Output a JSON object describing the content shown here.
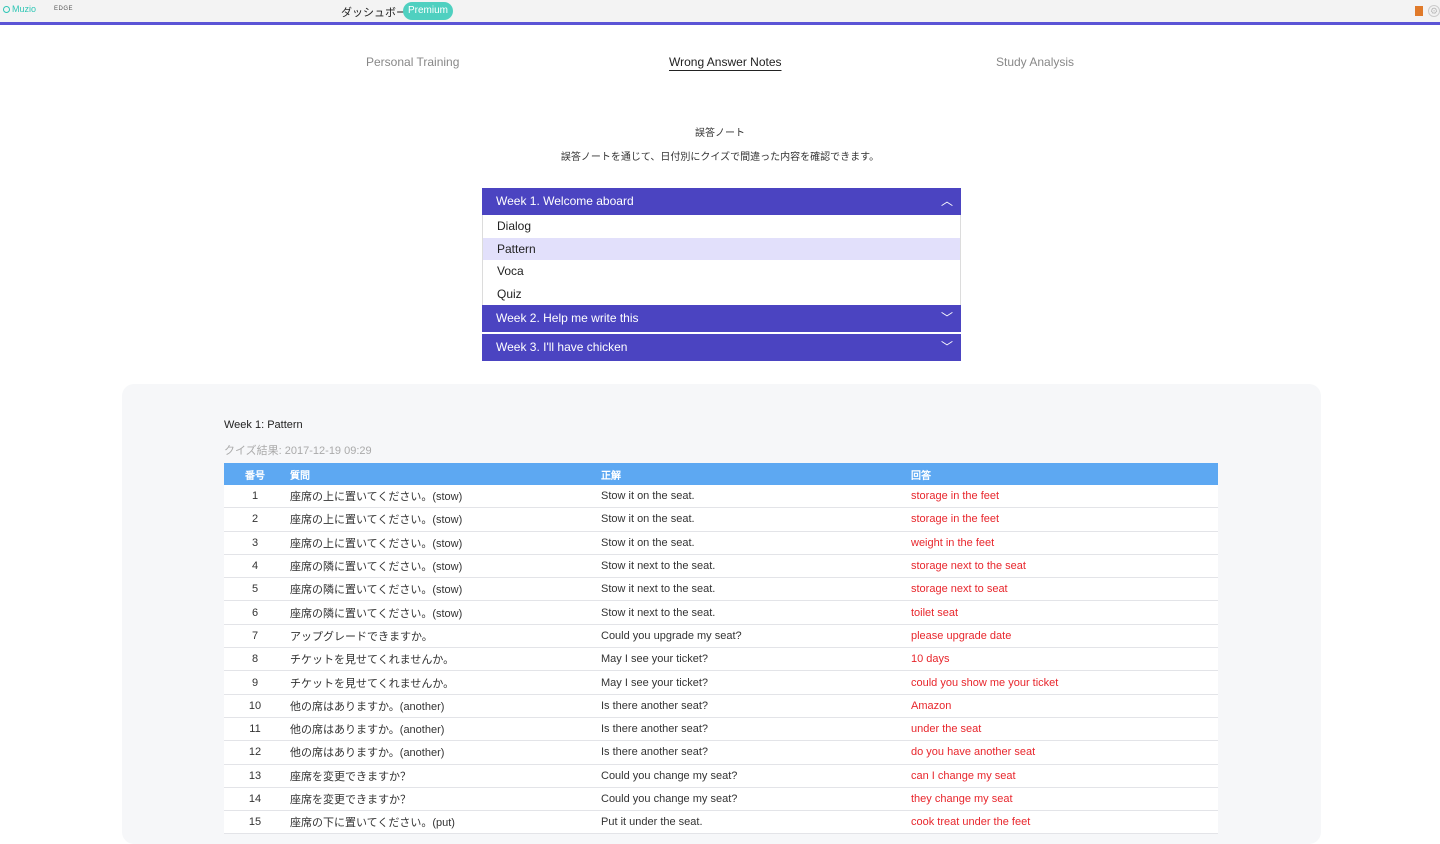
{
  "header": {
    "logo_text": "Muzio",
    "edge_text": "EDGE",
    "dashboard_label": "ダッシュボー",
    "premium_badge": "Premium",
    "accent_color": "#5b54d6"
  },
  "tabs": [
    {
      "label": "Personal Training",
      "active": false
    },
    {
      "label": "Wrong Answer Notes",
      "active": true
    },
    {
      "label": "Study Analysis",
      "active": false
    }
  ],
  "page": {
    "title": "誤答ノート",
    "description": "誤答ノートを通じて、日付別にクイズで間違った内容を確認できます。"
  },
  "accordion": {
    "weeks": [
      {
        "label": "Week 1. Welcome aboard",
        "expanded": true,
        "icon": "chevron-up-icon",
        "items": [
          "Dialog",
          "Pattern",
          "Voca",
          "Quiz"
        ],
        "selected_index": 1
      },
      {
        "label": "Week 2. Help me write this",
        "expanded": false,
        "icon": "chevron-down-icon"
      },
      {
        "label": "Week 3. I'll have chicken",
        "expanded": false,
        "icon": "chevron-down-icon"
      }
    ]
  },
  "result": {
    "title": "Week 1: Pattern",
    "date": "クイズ結果: 2017-12-19 09:29",
    "columns": [
      "番号",
      "質問",
      "正解",
      "回答"
    ],
    "rows": [
      [
        "1",
        "座席の上に置いてください。(stow)",
        "Stow it on the seat.",
        "storage in the feet"
      ],
      [
        "2",
        "座席の上に置いてください。(stow)",
        "Stow it on the seat.",
        "storage in the feet"
      ],
      [
        "3",
        "座席の上に置いてください。(stow)",
        "Stow it on the seat.",
        "weight in the feet"
      ],
      [
        "4",
        "座席の隣に置いてください。(stow)",
        "Stow it next to the seat.",
        "storage next to the seat"
      ],
      [
        "5",
        "座席の隣に置いてください。(stow)",
        "Stow it next to the seat.",
        "storage next to seat"
      ],
      [
        "6",
        "座席の隣に置いてください。(stow)",
        "Stow it next to the seat.",
        "toilet seat"
      ],
      [
        "7",
        "アップグレードできますか。",
        "Could you upgrade my seat?",
        "please upgrade date"
      ],
      [
        "8",
        "チケットを見せてくれませんか。",
        "May I see your ticket?",
        "10 days"
      ],
      [
        "9",
        "チケットを見せてくれませんか。",
        "May I see your ticket?",
        "could you show me your ticket"
      ],
      [
        "10",
        "他の席はありますか。(another)",
        "Is there another seat?",
        "Amazon"
      ],
      [
        "11",
        "他の席はありますか。(another)",
        "Is there another seat?",
        "under the seat"
      ],
      [
        "12",
        "他の席はありますか。(another)",
        "Is there another seat?",
        "do you have another seat"
      ],
      [
        "13",
        "座席を変更できますか？",
        "Could you change my seat?",
        "can I change my seat"
      ],
      [
        "14",
        "座席を変更できますか？",
        "Could you change my seat?",
        "they change my seat"
      ],
      [
        "15",
        "座席の下に置いてください。(put)",
        "Put it under the seat.",
        "cook treat under the feet"
      ]
    ]
  }
}
